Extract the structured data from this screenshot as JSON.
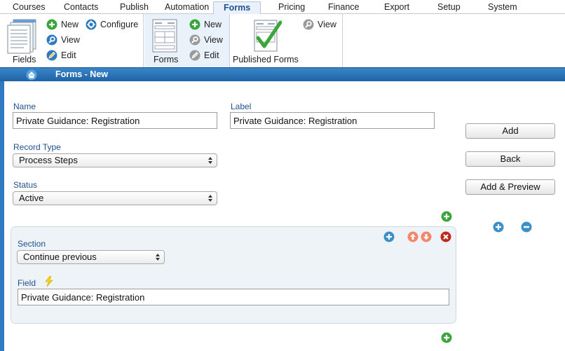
{
  "tabs": [
    "Courses",
    "Contacts",
    "Publish",
    "Automation",
    "Forms",
    "Pricing",
    "Finance",
    "Export",
    "Setup",
    "System"
  ],
  "active_tab": "Forms",
  "ribbon": {
    "fields_group": {
      "label": "Fields",
      "new": "New",
      "view": "View",
      "edit": "Edit",
      "configure": "Configure"
    },
    "forms_group": {
      "label": "Forms",
      "new": "New",
      "view": "View",
      "edit": "Edit"
    },
    "published_group": {
      "label": "Published Forms",
      "view": "View"
    }
  },
  "breadcrumb": {
    "title": "Forms - New"
  },
  "form": {
    "name_label": "Name",
    "name_value": "Private Guidance: Registration",
    "label_label": "Label",
    "label_value": "Private Guidance: Registration",
    "record_type_label": "Record Type",
    "record_type_value": "Process Steps",
    "status_label": "Status",
    "status_value": "Active"
  },
  "section": {
    "section_label": "Section",
    "section_value": "Continue previous",
    "field_label": "Field",
    "field_value": "Private Guidance: Registration"
  },
  "actions": {
    "add": "Add",
    "back": "Back",
    "add_preview": "Add & Preview"
  },
  "colors": {
    "accent_blue": "#2f7bc1",
    "label_blue": "#1f4f8f",
    "add_green": "#3aa53a",
    "up_down_orange": "#f2876b",
    "delete_red": "#c0281c",
    "section_plus_blue": "#3d8fc8"
  }
}
